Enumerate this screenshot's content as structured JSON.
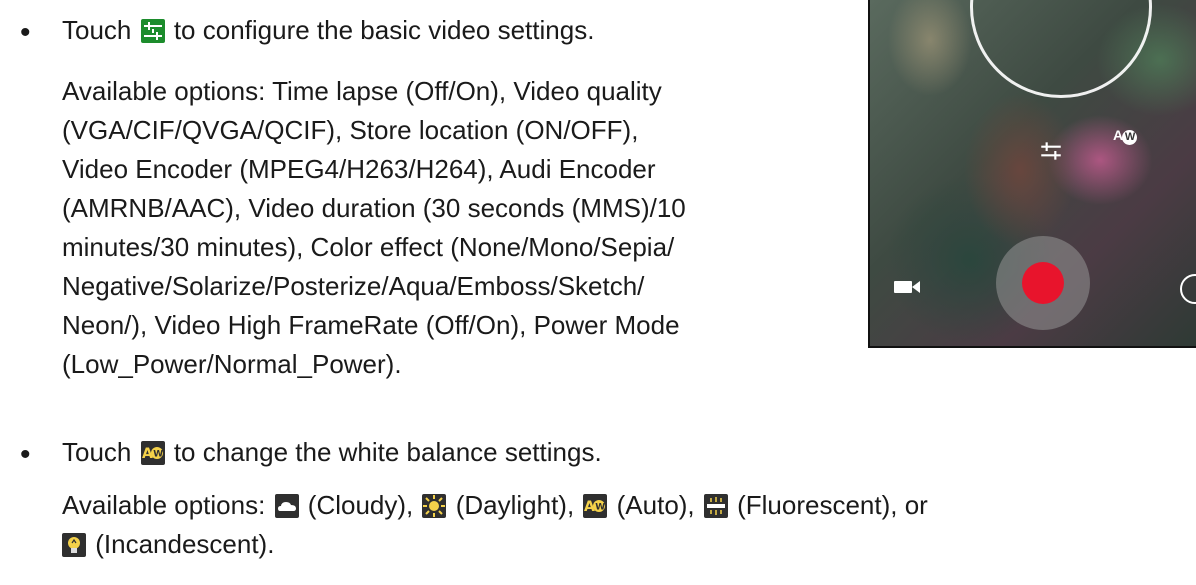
{
  "bullet_symbol": "•",
  "section1": {
    "line1_pre": "Touch ",
    "line1_post": " to configure the basic video settings.",
    "options_lines": [
      "Available options: Time lapse (Off/On), Video quality",
      "(VGA/CIF/QVGA/QCIF), Store location (ON/OFF),",
      "Video Encoder (MPEG4/H263/H264), Audi Encoder",
      "(AMRNB/AAC), Video duration (30 seconds (MMS)/10",
      "minutes/30 minutes), Color effect (None/Mono/Sepia/",
      "Negative/Solarize/Posterize/Aqua/Emboss/Sketch/",
      "Neon/), Video High FrameRate (Off/On), Power Mode",
      "(Low_Power/Normal_Power)."
    ]
  },
  "section2": {
    "line1_pre": "Touch ",
    "line1_post": " to change the white balance settings.",
    "options_pre": "Available options: ",
    "cloudy": " (Cloudy), ",
    "daylight": " (Daylight), ",
    "auto": " (Auto), ",
    "fluorescent": " (Fluorescent), or",
    "incandescent": " (Incandescent)."
  },
  "icons": {
    "settings": "settings-sliders-icon",
    "awb": "auto-white-balance-icon",
    "cloudy": "cloudy-icon",
    "daylight": "daylight-icon",
    "fluorescent": "fluorescent-icon",
    "incandescent": "incandescent-icon"
  },
  "phone": {
    "awb_label": "A",
    "awb_letter": "W"
  },
  "colors": {
    "settings_icon_bg": "#1c8c2c",
    "record_button": "#e8142c"
  }
}
